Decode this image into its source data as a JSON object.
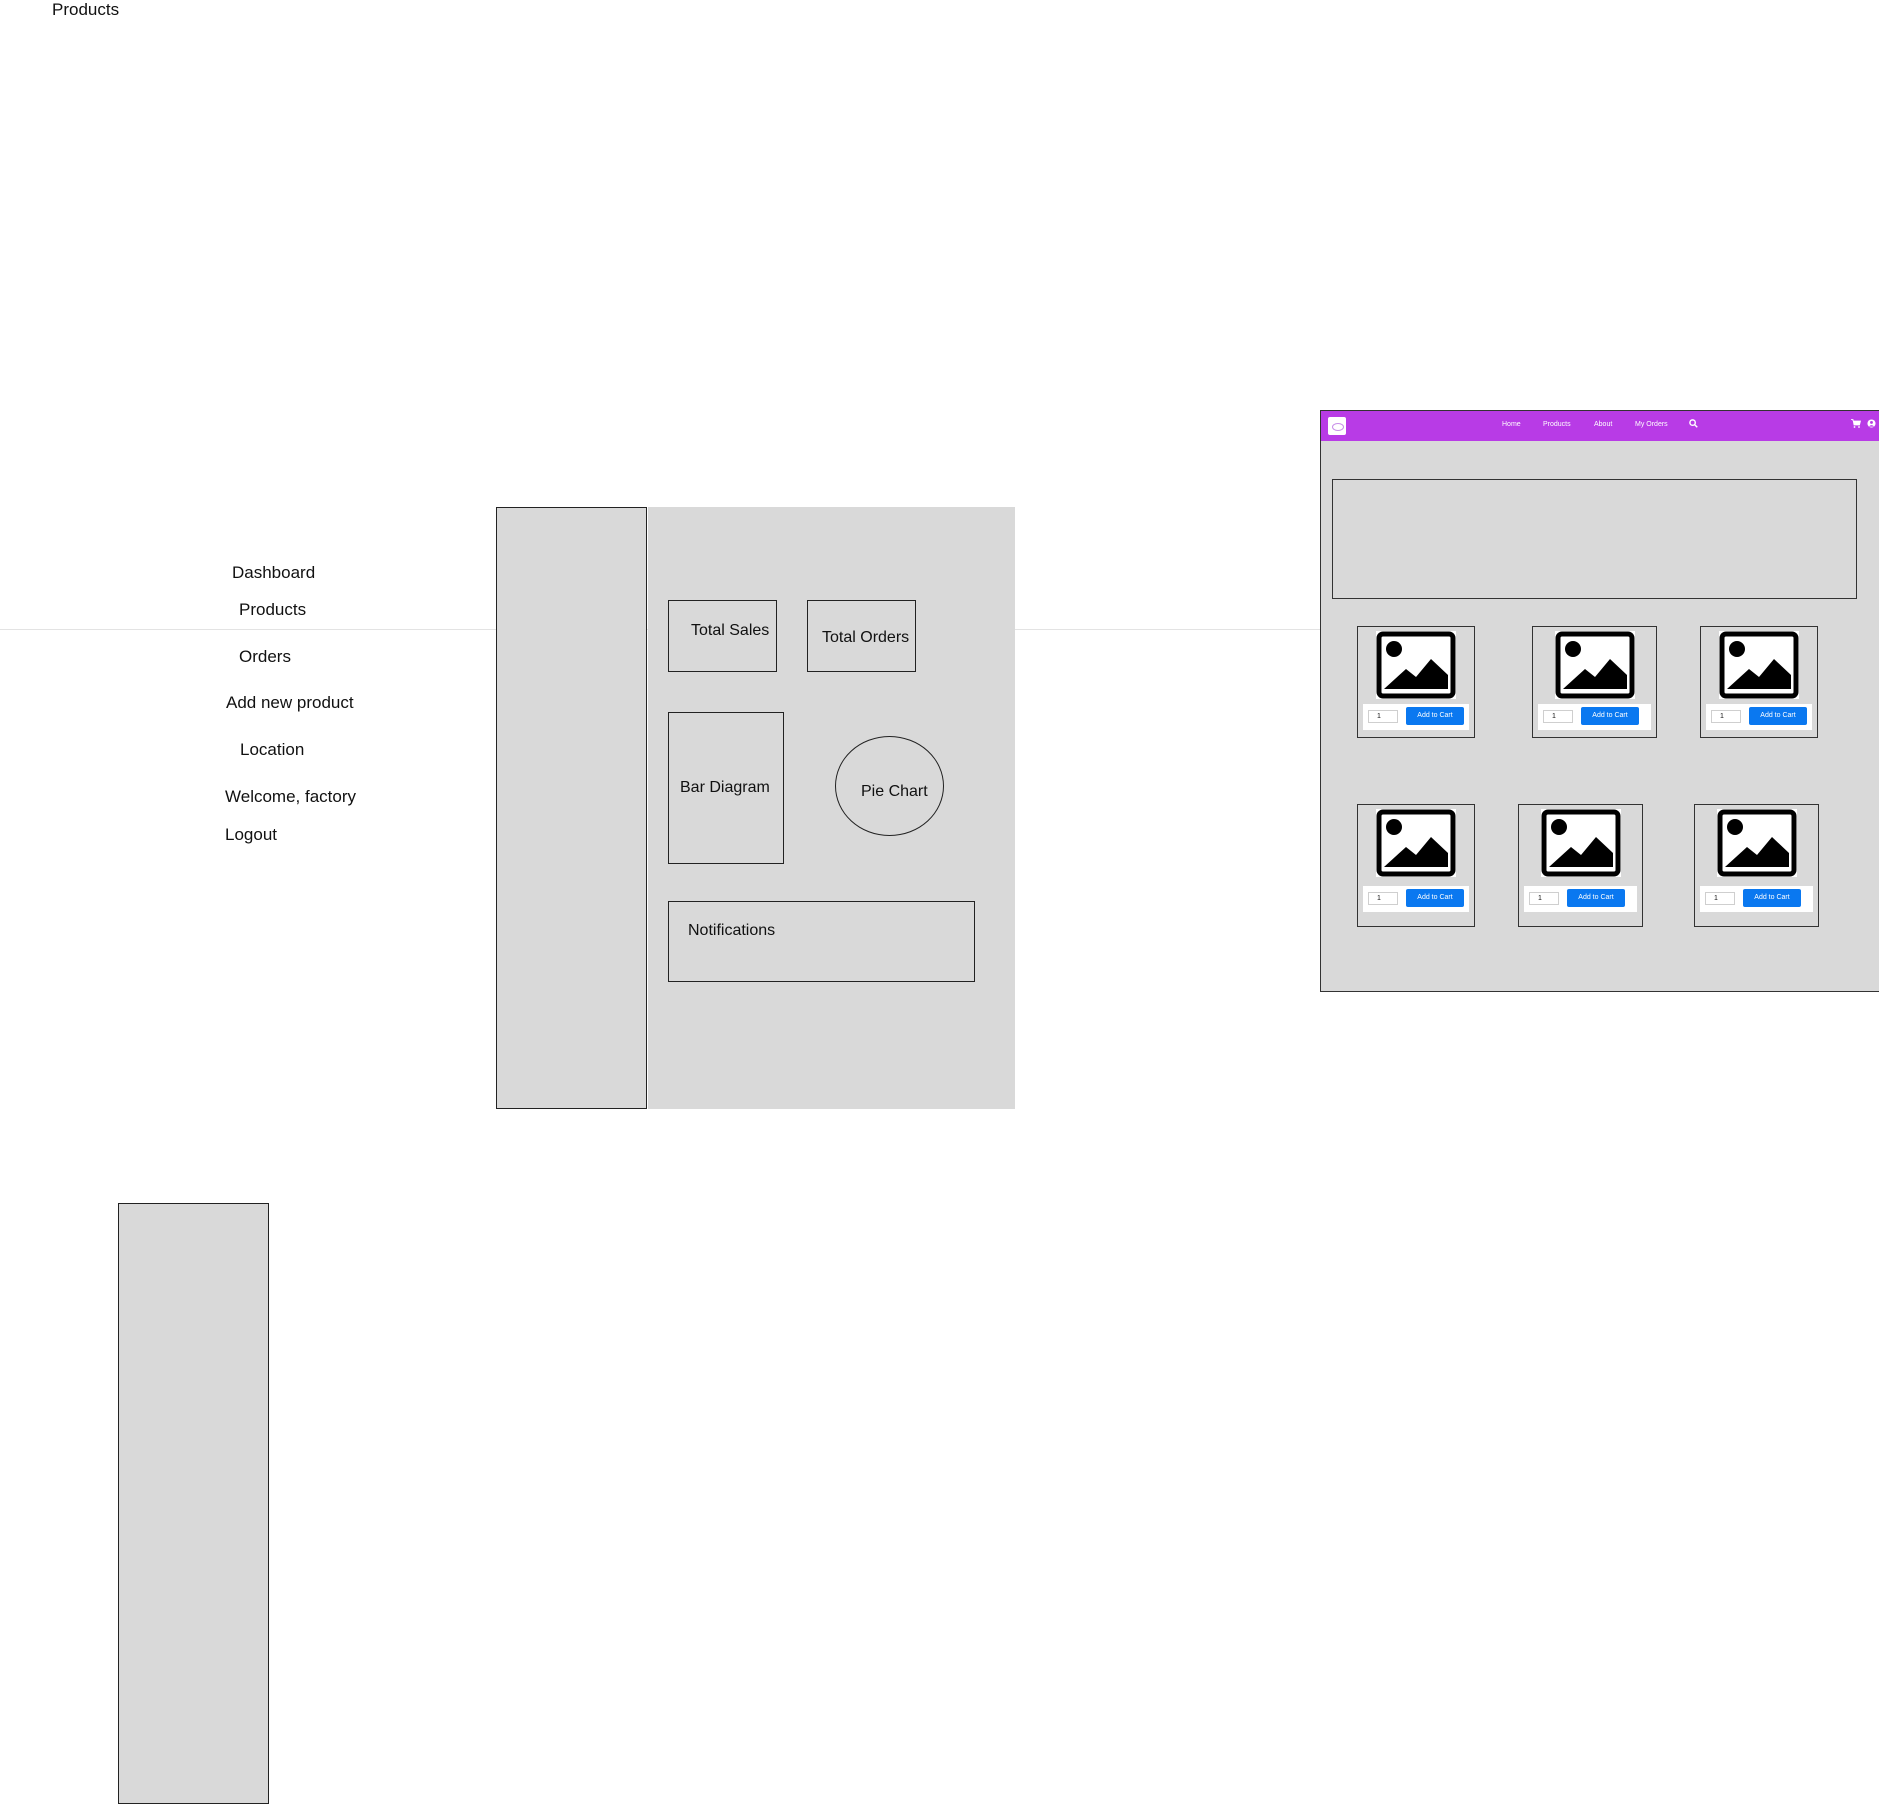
{
  "page": {
    "top_label": "Products"
  },
  "sidebar_nav": {
    "items": [
      {
        "label": "Dashboard"
      },
      {
        "label": "Products"
      },
      {
        "label": "Orders"
      },
      {
        "label": "Add new product"
      },
      {
        "label": "Location"
      },
      {
        "label": "Welcome, factory"
      },
      {
        "label": "Logout"
      }
    ]
  },
  "dashboard": {
    "total_sales": "Total Sales",
    "total_orders": "Total Orders",
    "bar_diagram": "Bar Diagram",
    "pie_chart": "Pie Chart",
    "notifications": "Notifications"
  },
  "shop": {
    "nav": {
      "home": "Home",
      "products": "Products",
      "about": "About",
      "my_orders": "My Orders",
      "search_icon": "search-icon",
      "cart_icon": "cart-icon",
      "user_icon": "user-icon"
    },
    "accent_color": "#b83be6",
    "button_color": "#0a78f0",
    "products": [
      {
        "qty": "1",
        "button": "Add to Cart"
      },
      {
        "qty": "1",
        "button": "Add to Cart"
      },
      {
        "qty": "1",
        "button": "Add to Cart"
      },
      {
        "qty": "1",
        "button": "Add to Cart"
      },
      {
        "qty": "1",
        "button": "Add to Cart"
      },
      {
        "qty": "1",
        "button": "Add to Cart"
      }
    ]
  }
}
